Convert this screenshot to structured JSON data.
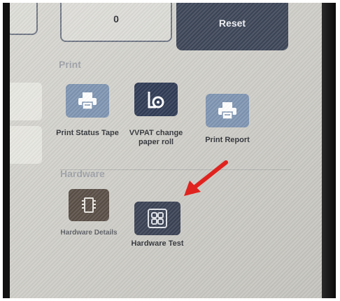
{
  "top": {
    "count_value": "0",
    "reset_label": "Reset"
  },
  "sections": {
    "print_title": "Print",
    "hardware_title": "Hardware"
  },
  "print_tiles": [
    {
      "label": "Print Status Tape",
      "icon": "printer-icon"
    },
    {
      "label": "VVPAT change paper roll",
      "icon": "paper-roll-icon"
    },
    {
      "label": "Print Report",
      "icon": "printer-icon"
    }
  ],
  "hardware_tiles": [
    {
      "label": "Hardware Details",
      "icon": "chip-icon"
    },
    {
      "label": "Hardware Test",
      "icon": "grid-icon"
    }
  ],
  "colors": {
    "accent_dark": "#3d4658",
    "tile_light": "#7f95b2",
    "tile_dark": "#2f3b55",
    "tile_brown": "#5a4f47",
    "annotation_arrow": "#e0231f"
  }
}
